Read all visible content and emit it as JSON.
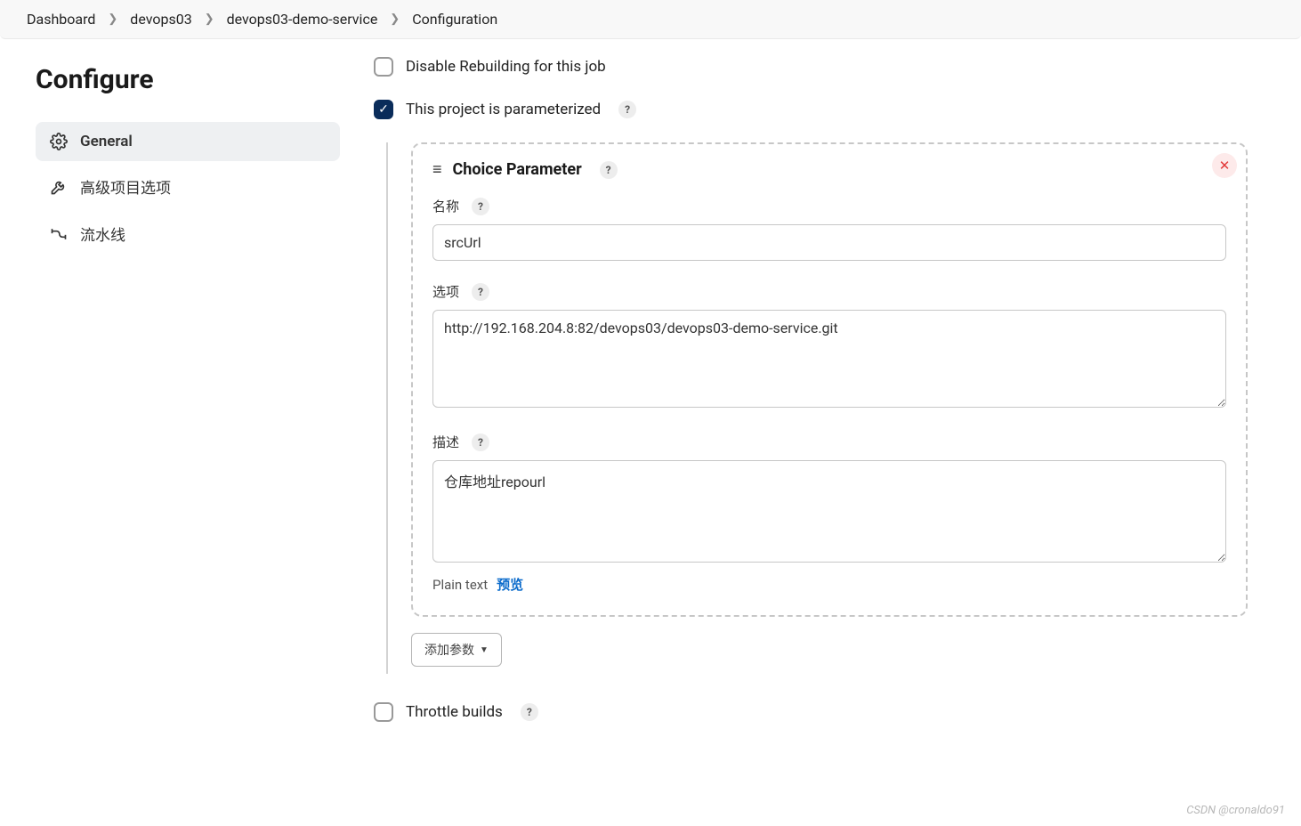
{
  "breadcrumb": {
    "items": [
      "Dashboard",
      "devops03",
      "devops03-demo-service",
      "Configuration"
    ]
  },
  "sidebar": {
    "title": "Configure",
    "items": [
      {
        "label": "General",
        "icon": "gear-icon"
      },
      {
        "label": "高级项目选项",
        "icon": "wrench-icon"
      },
      {
        "label": "流水线",
        "icon": "pipeline-icon"
      }
    ]
  },
  "options": {
    "disable_rebuild_label": "Disable Rebuilding for this job",
    "parameterized_label": "This project is parameterized",
    "throttle_label": "Throttle builds"
  },
  "parameter": {
    "type_label": "Choice Parameter",
    "name_label": "名称",
    "name_value": "srcUrl",
    "choices_label": "选项",
    "choices_value": "http://192.168.204.8:82/devops03/devops03-demo-service.git",
    "desc_label": "描述",
    "desc_value": "仓库地址repourl",
    "plain_text_label": "Plain text",
    "preview_label": "预览"
  },
  "buttons": {
    "add_param": "添加参数"
  },
  "help_glyph": "?",
  "watermark": "CSDN @cronaldo91"
}
